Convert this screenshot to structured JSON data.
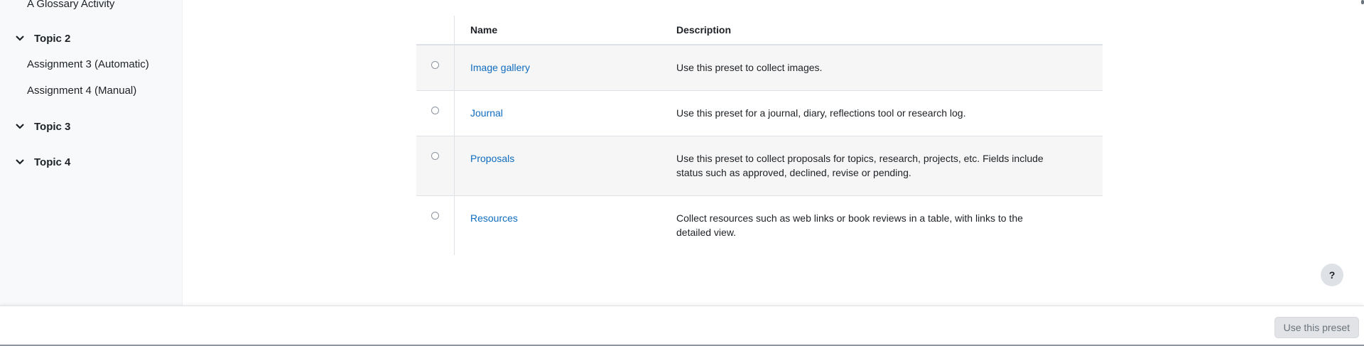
{
  "sidebar": {
    "items": [
      {
        "label": "A Glossary Activity"
      },
      {
        "label": "Assignment 3 (Automatic)"
      },
      {
        "label": "Assignment 4 (Manual)"
      }
    ],
    "topics": [
      {
        "label": "Topic 2"
      },
      {
        "label": "Topic 3"
      },
      {
        "label": "Topic 4"
      }
    ]
  },
  "table": {
    "headers": {
      "name": "Name",
      "description": "Description"
    },
    "rows": [
      {
        "name": "Image gallery",
        "description": "Use this preset to collect images."
      },
      {
        "name": "Journal",
        "description": "Use this preset for a journal, diary, reflections tool or research log."
      },
      {
        "name": "Proposals",
        "description": "Use this preset to collect proposals for topics, research, projects, etc. Fields include status such as approved, declined, revise or pending."
      },
      {
        "name": "Resources",
        "description": "Collect resources such as web links or book reviews in a table, with links to the detailed view."
      }
    ]
  },
  "help": {
    "label": "?"
  },
  "footer": {
    "use_preset_label": "Use this preset"
  },
  "icons": {
    "topic_toggle": "chevron-down-icon",
    "help": "question-icon"
  },
  "colors": {
    "link": "#0f6cbf",
    "sidebar_bg": "#f8f9fa",
    "row_alt_bg": "#f6f6f6"
  }
}
